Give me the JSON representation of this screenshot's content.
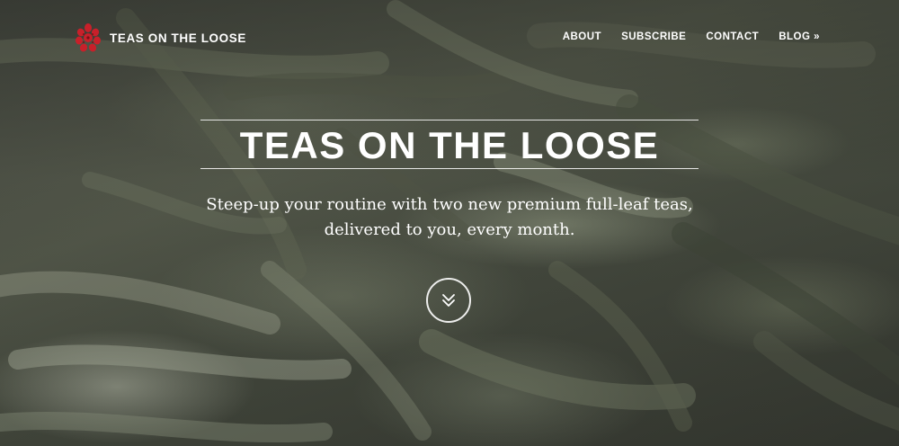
{
  "brand": {
    "name": "TEAS ON THE LOOSE",
    "logo_icon": "red-leaf-cluster-icon",
    "logo_color": "#c8202a"
  },
  "nav": {
    "items": [
      {
        "label": "ABOUT"
      },
      {
        "label": "SUBSCRIBE"
      },
      {
        "label": "CONTACT"
      },
      {
        "label": "BLOG »"
      }
    ]
  },
  "hero": {
    "headline": "TEAS ON THE LOOSE",
    "tagline_line1": "Steep-up your routine with two new premium full-leaf teas,",
    "tagline_line2": "delivered to you, every month.",
    "scroll_icon": "double-chevron-down-icon"
  }
}
